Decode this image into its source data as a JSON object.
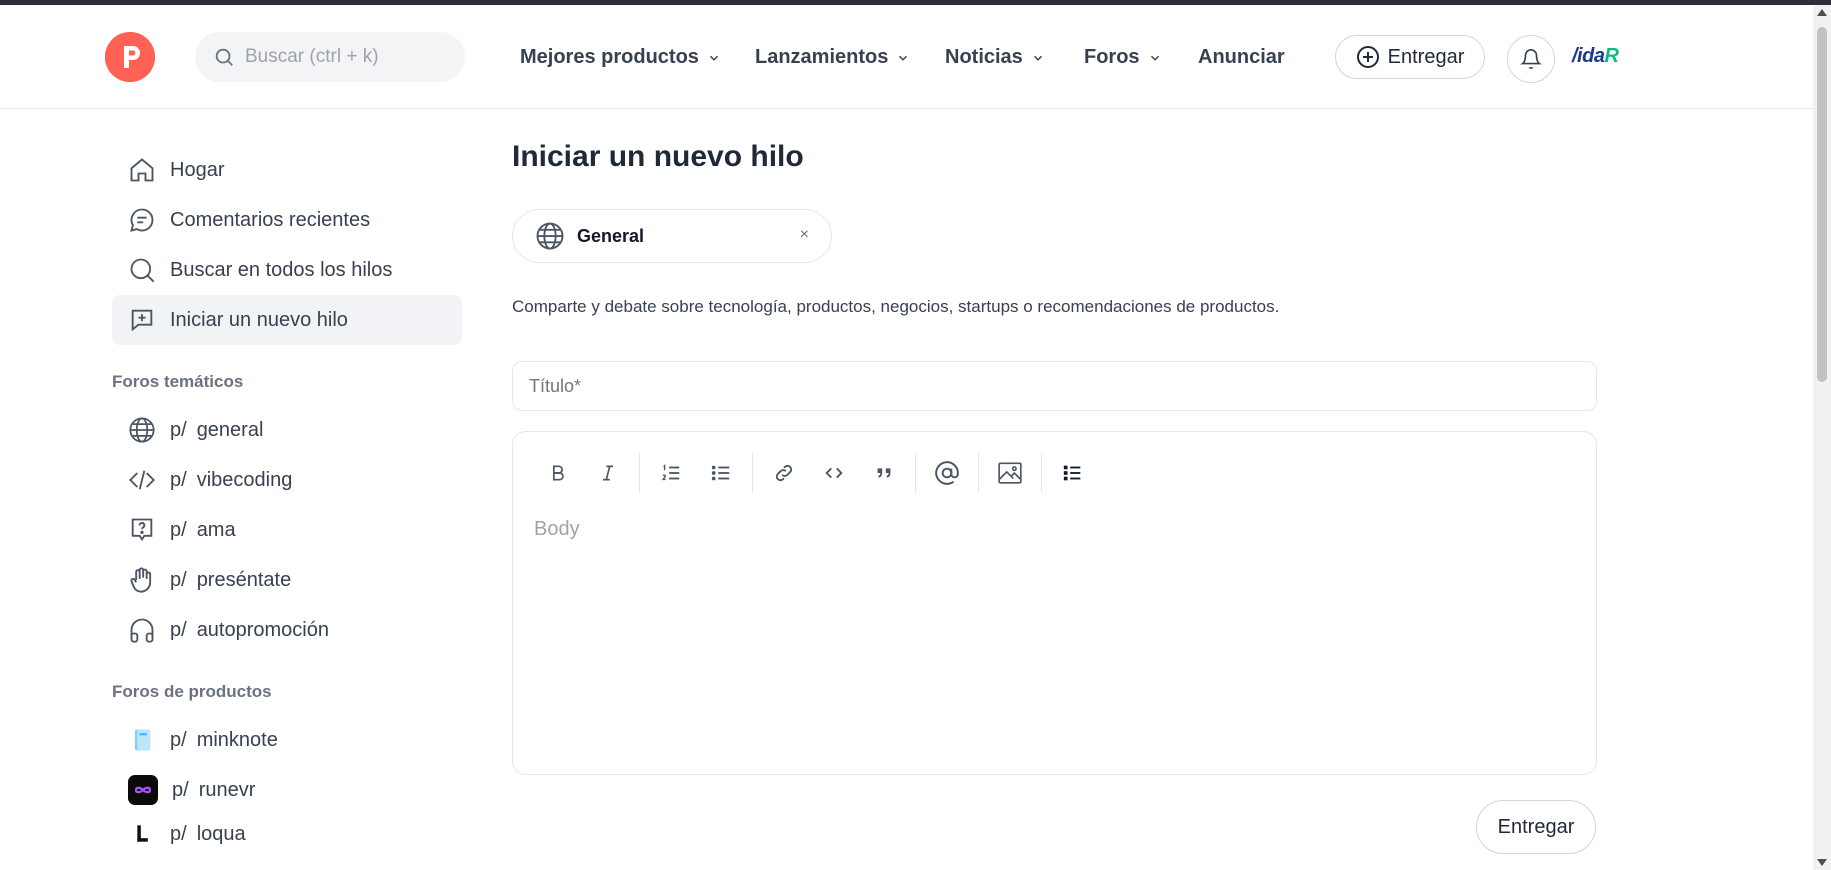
{
  "colors": {
    "brand": "#ff6154",
    "topbar": "#2e2d3a",
    "active_bg": "#f1f3f6"
  },
  "header": {
    "logo_letter": "P",
    "search_placeholder": "Buscar (ctrl + k)",
    "nav": [
      {
        "label": "Mejores productos",
        "has_dropdown": true
      },
      {
        "label": "Lanzamientos",
        "has_dropdown": true
      },
      {
        "label": "Noticias",
        "has_dropdown": true
      },
      {
        "label": "Foros",
        "has_dropdown": true
      },
      {
        "label": "Anunciar",
        "has_dropdown": false
      }
    ],
    "submit_label": "Entregar",
    "brand_text": "/ida",
    "brand_text_accent": "R"
  },
  "sidebar": {
    "items": [
      {
        "label": "Hogar",
        "icon": "home-icon"
      },
      {
        "label": "Comentarios recientes",
        "icon": "comment-icon"
      },
      {
        "label": "Buscar en todos los hilos",
        "icon": "search-icon"
      },
      {
        "label": "Iniciar un nuevo hilo",
        "icon": "new-thread-icon",
        "active": true
      }
    ],
    "topic_heading": "Foros temáticos",
    "topic_forums": [
      {
        "prefix": "p/",
        "name": "general",
        "icon": "globe-icon"
      },
      {
        "prefix": "p/",
        "name": "vibecoding",
        "icon": "code-icon"
      },
      {
        "prefix": "p/",
        "name": "ama",
        "icon": "question-icon"
      },
      {
        "prefix": "p/",
        "name": "preséntate",
        "icon": "hand-icon"
      },
      {
        "prefix": "p/",
        "name": "autopromoción",
        "icon": "headphones-icon"
      }
    ],
    "product_heading": "Foros de productos",
    "product_forums": [
      {
        "prefix": "p/",
        "name": "minknote",
        "icon": "notebook-icon"
      },
      {
        "prefix": "p/",
        "name": "runevr",
        "icon": "infinity-icon"
      },
      {
        "prefix": "p/",
        "name": "loqua",
        "icon": "loqua-icon"
      }
    ]
  },
  "main": {
    "title": "Iniciar un nuevo hilo",
    "chip_label": "General",
    "chip_close": "×",
    "description": "Comparte y debate sobre tecnología, productos, negocios, startups o recomendaciones de productos.",
    "title_placeholder": "Título*",
    "body_placeholder": "Body",
    "toolbar": [
      "bold",
      "italic",
      "ordered-list",
      "bullet-list",
      "link",
      "code",
      "quote",
      "mention",
      "image",
      "list"
    ],
    "submit_label": "Entregar"
  }
}
